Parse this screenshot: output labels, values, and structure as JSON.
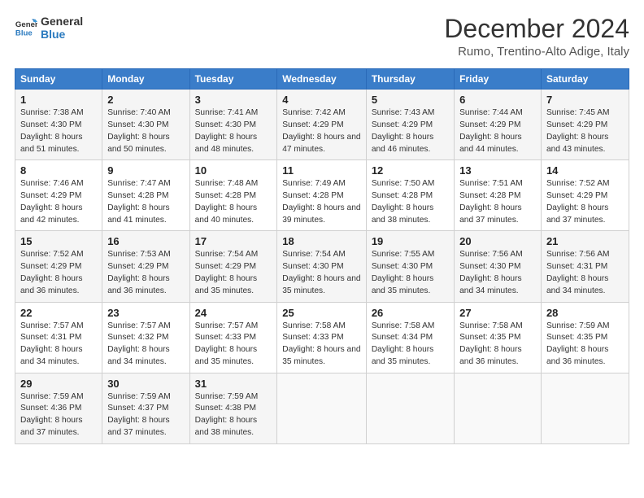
{
  "header": {
    "logo_line1": "General",
    "logo_line2": "Blue",
    "month": "December 2024",
    "location": "Rumo, Trentino-Alto Adige, Italy"
  },
  "days_of_week": [
    "Sunday",
    "Monday",
    "Tuesday",
    "Wednesday",
    "Thursday",
    "Friday",
    "Saturday"
  ],
  "weeks": [
    [
      {
        "day": 1,
        "sunrise": "7:38 AM",
        "sunset": "4:30 PM",
        "daylight": "8 hours and 51 minutes."
      },
      {
        "day": 2,
        "sunrise": "7:40 AM",
        "sunset": "4:30 PM",
        "daylight": "8 hours and 50 minutes."
      },
      {
        "day": 3,
        "sunrise": "7:41 AM",
        "sunset": "4:30 PM",
        "daylight": "8 hours and 48 minutes."
      },
      {
        "day": 4,
        "sunrise": "7:42 AM",
        "sunset": "4:29 PM",
        "daylight": "8 hours and 47 minutes."
      },
      {
        "day": 5,
        "sunrise": "7:43 AM",
        "sunset": "4:29 PM",
        "daylight": "8 hours and 46 minutes."
      },
      {
        "day": 6,
        "sunrise": "7:44 AM",
        "sunset": "4:29 PM",
        "daylight": "8 hours and 44 minutes."
      },
      {
        "day": 7,
        "sunrise": "7:45 AM",
        "sunset": "4:29 PM",
        "daylight": "8 hours and 43 minutes."
      }
    ],
    [
      {
        "day": 8,
        "sunrise": "7:46 AM",
        "sunset": "4:29 PM",
        "daylight": "8 hours and 42 minutes."
      },
      {
        "day": 9,
        "sunrise": "7:47 AM",
        "sunset": "4:28 PM",
        "daylight": "8 hours and 41 minutes."
      },
      {
        "day": 10,
        "sunrise": "7:48 AM",
        "sunset": "4:28 PM",
        "daylight": "8 hours and 40 minutes."
      },
      {
        "day": 11,
        "sunrise": "7:49 AM",
        "sunset": "4:28 PM",
        "daylight": "8 hours and 39 minutes."
      },
      {
        "day": 12,
        "sunrise": "7:50 AM",
        "sunset": "4:28 PM",
        "daylight": "8 hours and 38 minutes."
      },
      {
        "day": 13,
        "sunrise": "7:51 AM",
        "sunset": "4:28 PM",
        "daylight": "8 hours and 37 minutes."
      },
      {
        "day": 14,
        "sunrise": "7:52 AM",
        "sunset": "4:29 PM",
        "daylight": "8 hours and 37 minutes."
      }
    ],
    [
      {
        "day": 15,
        "sunrise": "7:52 AM",
        "sunset": "4:29 PM",
        "daylight": "8 hours and 36 minutes."
      },
      {
        "day": 16,
        "sunrise": "7:53 AM",
        "sunset": "4:29 PM",
        "daylight": "8 hours and 36 minutes."
      },
      {
        "day": 17,
        "sunrise": "7:54 AM",
        "sunset": "4:29 PM",
        "daylight": "8 hours and 35 minutes."
      },
      {
        "day": 18,
        "sunrise": "7:54 AM",
        "sunset": "4:30 PM",
        "daylight": "8 hours and 35 minutes."
      },
      {
        "day": 19,
        "sunrise": "7:55 AM",
        "sunset": "4:30 PM",
        "daylight": "8 hours and 35 minutes."
      },
      {
        "day": 20,
        "sunrise": "7:56 AM",
        "sunset": "4:30 PM",
        "daylight": "8 hours and 34 minutes."
      },
      {
        "day": 21,
        "sunrise": "7:56 AM",
        "sunset": "4:31 PM",
        "daylight": "8 hours and 34 minutes."
      }
    ],
    [
      {
        "day": 22,
        "sunrise": "7:57 AM",
        "sunset": "4:31 PM",
        "daylight": "8 hours and 34 minutes."
      },
      {
        "day": 23,
        "sunrise": "7:57 AM",
        "sunset": "4:32 PM",
        "daylight": "8 hours and 34 minutes."
      },
      {
        "day": 24,
        "sunrise": "7:57 AM",
        "sunset": "4:33 PM",
        "daylight": "8 hours and 35 minutes."
      },
      {
        "day": 25,
        "sunrise": "7:58 AM",
        "sunset": "4:33 PM",
        "daylight": "8 hours and 35 minutes."
      },
      {
        "day": 26,
        "sunrise": "7:58 AM",
        "sunset": "4:34 PM",
        "daylight": "8 hours and 35 minutes."
      },
      {
        "day": 27,
        "sunrise": "7:58 AM",
        "sunset": "4:35 PM",
        "daylight": "8 hours and 36 minutes."
      },
      {
        "day": 28,
        "sunrise": "7:59 AM",
        "sunset": "4:35 PM",
        "daylight": "8 hours and 36 minutes."
      }
    ],
    [
      {
        "day": 29,
        "sunrise": "7:59 AM",
        "sunset": "4:36 PM",
        "daylight": "8 hours and 37 minutes."
      },
      {
        "day": 30,
        "sunrise": "7:59 AM",
        "sunset": "4:37 PM",
        "daylight": "8 hours and 37 minutes."
      },
      {
        "day": 31,
        "sunrise": "7:59 AM",
        "sunset": "4:38 PM",
        "daylight": "8 hours and 38 minutes."
      },
      null,
      null,
      null,
      null
    ]
  ]
}
